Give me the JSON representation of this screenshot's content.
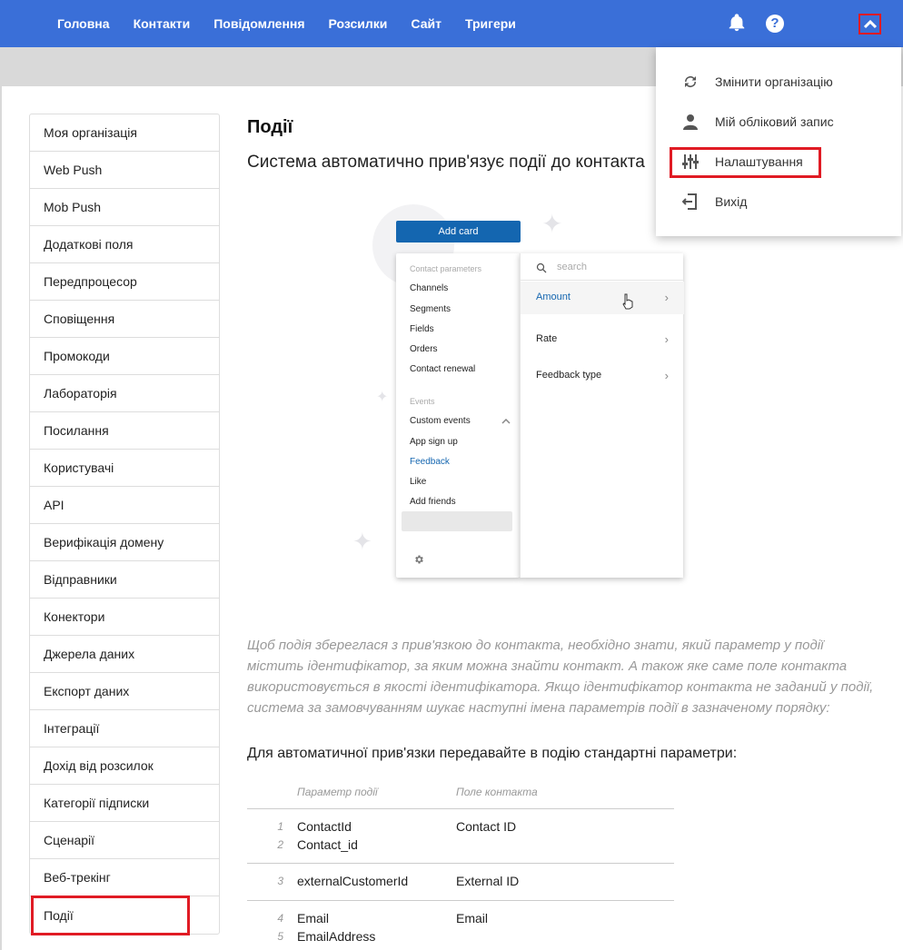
{
  "nav": {
    "items": [
      "Головна",
      "Контакти",
      "Повідомлення",
      "Розсилки",
      "Сайт",
      "Тригери"
    ],
    "help_glyph": "?"
  },
  "dropdown": {
    "items": [
      {
        "label": "Змінити організацію",
        "icon": "sync-icon"
      },
      {
        "label": "Мій обліковий запис",
        "icon": "user-icon"
      },
      {
        "label": "Налаштування",
        "icon": "sliders-icon"
      },
      {
        "label": "Вихід",
        "icon": "logout-icon"
      }
    ]
  },
  "sidebar": {
    "items": [
      "Моя організація",
      "Web Push",
      "Mob Push",
      "Додаткові поля",
      "Передпроцесор",
      "Сповіщення",
      "Промокоди",
      "Лабораторія",
      "Посилання",
      "Користувачі",
      "API",
      "Верифікація домену",
      "Відправники",
      "Конектори",
      "Джерела даних",
      "Експорт даних",
      "Інтеграції",
      "Дохід від розсилок",
      "Категорії підписки",
      "Сценарії",
      "Веб-трекінг",
      "Події"
    ],
    "active": "Події"
  },
  "main": {
    "title": "Події",
    "subtitle": "Система автоматично прив'язує події до контакта",
    "note": "Щоб подія збереглася з прив'язкою до контакта, необхідно знати, який параметр у події містить ідентифікатор, за яким можна знайти контакт. А також яке саме поле контакта використовується в якості ідентифікатора. Якщо ідентифікатор контакта не заданий у події, система за замовчуванням шукає наступні імена параметрів події в зазначеному порядку:",
    "paragraph": "Для автоматичної прив'язки передавайте в подію стандартні параметри:"
  },
  "illustration": {
    "add_card": "Add card",
    "left_menu": {
      "contact_header": "Contact parameters",
      "contact_items": [
        "Channels",
        "Segments",
        "Fields",
        "Orders",
        "Contact renewal"
      ],
      "events_header": "Events",
      "event_items": [
        "Custom events",
        "App sign up",
        "Feedback",
        "Like",
        "Add friends"
      ],
      "selected": "Feedback"
    },
    "right_menu": {
      "search_placeholder": "search",
      "items": [
        "Amount",
        "Rate",
        "Feedback type"
      ]
    }
  },
  "table": {
    "headers": [
      "Параметр події",
      "Поле контакта"
    ],
    "rows": [
      {
        "params": [
          {
            "n": "1",
            "name": "ContactId"
          },
          {
            "n": "2",
            "name": "Contact_id"
          }
        ],
        "field": "Contact ID"
      },
      {
        "params": [
          {
            "n": "3",
            "name": "externalCustomerId"
          }
        ],
        "field": "External ID"
      },
      {
        "params": [
          {
            "n": "4",
            "name": "Email"
          },
          {
            "n": "5",
            "name": "EmailAddress"
          }
        ],
        "field": "Email"
      }
    ]
  },
  "colors": {
    "topbar": "#3a6fd8",
    "highlight": "#e01b24",
    "accent_blue": "#1466b0"
  }
}
